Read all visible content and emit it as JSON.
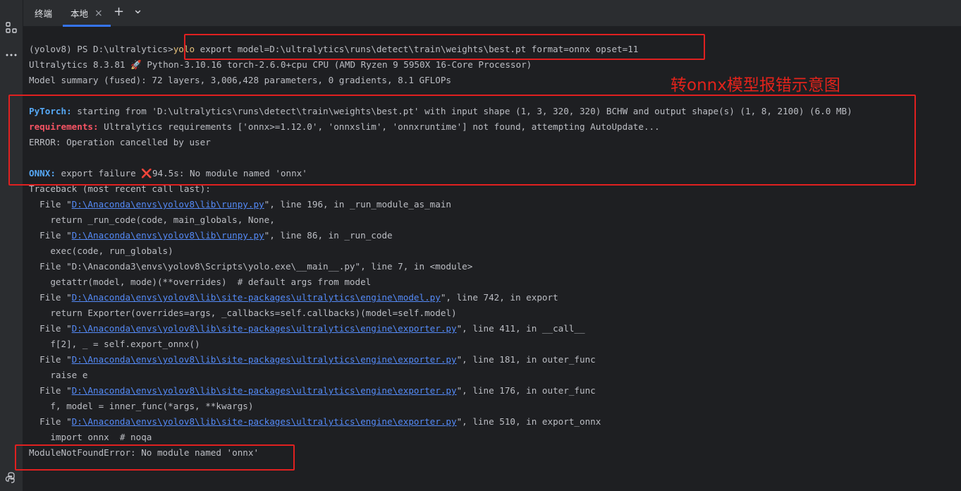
{
  "tabs": {
    "terminal_label": "终端",
    "local_label": "本地",
    "close_glyph": "×",
    "add_glyph": "+",
    "dropdown_glyph": "⌄"
  },
  "sidebar": {
    "icons": [
      "structure-icon",
      "more-icon",
      "python-icon"
    ]
  },
  "terminal": {
    "prompt": "(yolov8) PS D:\\ultralytics>",
    "cmd_yolo": "yolo",
    "cmd_args": " export model=D:\\ultralytics\\runs\\detect\\train\\weights\\best.pt format=onnx opset=11",
    "line_version_a": "Ultralytics 8.3.81 ",
    "line_version_b": " Python-3.10.16 torch-2.6.0+cpu CPU (AMD Ryzen 9 5950X 16-Core Processor)",
    "line_summary": "Model summary (fused): 72 layers, 3,006,428 parameters, 0 gradients, 8.1 GFLOPs",
    "pytorch_label": "PyTorch:",
    "pytorch_text": " starting from 'D:\\ultralytics\\runs\\detect\\train\\weights\\best.pt' with input shape (1, 3, 320, 320) BCHW and output shape(s) (1, 8, 2100) (6.0 MB)",
    "req_label": "requirements:",
    "req_text": " Ultralytics requirements ['onnx>=1.12.0', 'onnxslim', 'onnxruntime'] not found, attempting AutoUpdate...",
    "error_cancel": "ERROR: Operation cancelled by user",
    "onnx_label": "ONNX:",
    "onnx_text_a": " export failure ",
    "onnx_x": "❌",
    "onnx_text_b": "94.5s: No module named 'onnx'",
    "traceback": "Traceback (most recent call last):",
    "tb1_pre": "  File \"",
    "tb1_link": "D:\\Anaconda\\envs\\yolov8\\lib\\runpy.py",
    "tb1_post": "\", line 196, in _run_module_as_main",
    "tb1_code": "    return _run_code(code, main_globals, None,",
    "tb2_pre": "  File \"",
    "tb2_link": "D:\\Anaconda\\envs\\yolov8\\lib\\runpy.py",
    "tb2_post": "\", line 86, in _run_code",
    "tb2_code": "    exec(code, run_globals)",
    "tb3": "  File \"D:\\Anaconda3\\envs\\yolov8\\Scripts\\yolo.exe\\__main__.py\", line 7, in <module>",
    "tb3_code": "    getattr(model, mode)(**overrides)  # default args from model",
    "tb4_pre": "  File \"",
    "tb4_link": "D:\\Anaconda\\envs\\yolov8\\lib\\site-packages\\ultralytics\\engine\\model.py",
    "tb4_post": "\", line 742, in export",
    "tb4_code": "    return Exporter(overrides=args, _callbacks=self.callbacks)(model=self.model)",
    "tb5_pre": "  File \"",
    "tb5_link": "D:\\Anaconda\\envs\\yolov8\\lib\\site-packages\\ultralytics\\engine\\exporter.py",
    "tb5_post": "\", line 411, in __call__",
    "tb5_code": "    f[2], _ = self.export_onnx()",
    "tb6_pre": "  File \"",
    "tb6_link": "D:\\Anaconda\\envs\\yolov8\\lib\\site-packages\\ultralytics\\engine\\exporter.py",
    "tb6_post": "\", line 181, in outer_func",
    "tb6_code": "    raise e",
    "tb7_pre": "  File \"",
    "tb7_link": "D:\\Anaconda\\envs\\yolov8\\lib\\site-packages\\ultralytics\\engine\\exporter.py",
    "tb7_post": "\", line 176, in outer_func",
    "tb7_code": "    f, model = inner_func(*args, **kwargs)",
    "tb8_pre": "  File \"",
    "tb8_link": "D:\\Anaconda\\envs\\yolov8\\lib\\site-packages\\ultralytics\\engine\\exporter.py",
    "tb8_post": "\", line 510, in export_onnx",
    "tb8_code": "    import onnx  # noqa",
    "final_error": "ModuleNotFoundError: No module named 'onnx'"
  },
  "annotation": "转onnx模型报错示意图",
  "colors": {
    "background": "#1e1f22",
    "text": "#bcbec4",
    "annotation_red": "#e02020",
    "link": "#548af7",
    "accent_tab": "#3574f0"
  }
}
